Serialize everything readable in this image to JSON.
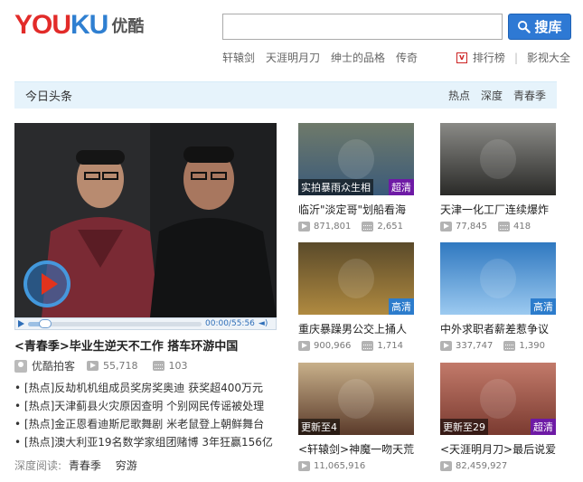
{
  "header": {
    "logo_you": "YOU",
    "logo_ku": "KU",
    "logo_cn": "优酷",
    "search_placeholder": "",
    "search_button": "搜库",
    "hotwords": [
      "轩辕剑",
      "天涯明月刀",
      "绅士的品格",
      "传奇"
    ],
    "ranking_icon": "v",
    "ranking_label": "排行榜",
    "separator": "|",
    "movies_label": "影视大全"
  },
  "section": {
    "title": "今日头条",
    "tabs": [
      "热点",
      "深度",
      "青春季"
    ]
  },
  "main": {
    "time": "00:00/55:56",
    "progress": 0.1,
    "title": "<青春季>毕业生逆天不工作 搭车环游中国",
    "uploader": "优酷拍客",
    "views": "55,718",
    "comments": "103",
    "news": [
      "•  [热点]反劫机机组成员奖房奖奥迪 获奖超400万元",
      "•  [热点]天津蓟县火灾原因查明 个别网民传谣被处理",
      "•  [热点]金正恩看迪斯尼歌舞剧 米老鼠登上朝鲜舞台",
      "•  [热点]澳大利亚19名数学家组团赌博 3年狂赢156亿"
    ],
    "deep_label": "深度阅读:",
    "deep_links": [
      "青春季",
      "穷游"
    ]
  },
  "cards": [
    {
      "caption": "实拍暴雨众生相",
      "badge": "超清",
      "badge_type": "chq",
      "title": "临沂\"淡定哥\"划船看海",
      "views": "871,801",
      "comments": "2,651",
      "colors": [
        "#6f7a6a",
        "#3a5a7a"
      ]
    },
    {
      "caption": "",
      "badge": "",
      "badge_type": "",
      "title": "天津一化工厂连续爆炸",
      "views": "77,845",
      "comments": "418",
      "colors": [
        "#8a8a86",
        "#2a2a28"
      ]
    },
    {
      "caption": "",
      "badge": "高清",
      "badge_type": "hd",
      "title": "重庆暴躁男公交上捅人",
      "views": "900,966",
      "comments": "1,714",
      "colors": [
        "#5a4a2a",
        "#b08a40"
      ]
    },
    {
      "caption": "",
      "badge": "高清",
      "badge_type": "hd",
      "title": "中外求职者薪差惹争议",
      "views": "337,747",
      "comments": "1,390",
      "colors": [
        "#2f78c0",
        "#9ccaf0"
      ]
    },
    {
      "caption": "更新至4",
      "badge": "",
      "badge_type": "",
      "title": "<轩辕剑>神魔一吻天荒",
      "views": "11,065,916",
      "comments": "",
      "colors": [
        "#c8b08a",
        "#5a3a2a"
      ]
    },
    {
      "caption": "更新至29",
      "badge": "超清",
      "badge_type": "chq",
      "title": "<天涯明月刀>最后说爱",
      "views": "82,459,927",
      "comments": "",
      "colors": [
        "#c27a6a",
        "#7a3a30"
      ]
    }
  ],
  "icons": {
    "search": "search-icon",
    "play": "play-icon",
    "comment": "comment-icon",
    "user": "user-icon",
    "volume": "volume-icon"
  }
}
